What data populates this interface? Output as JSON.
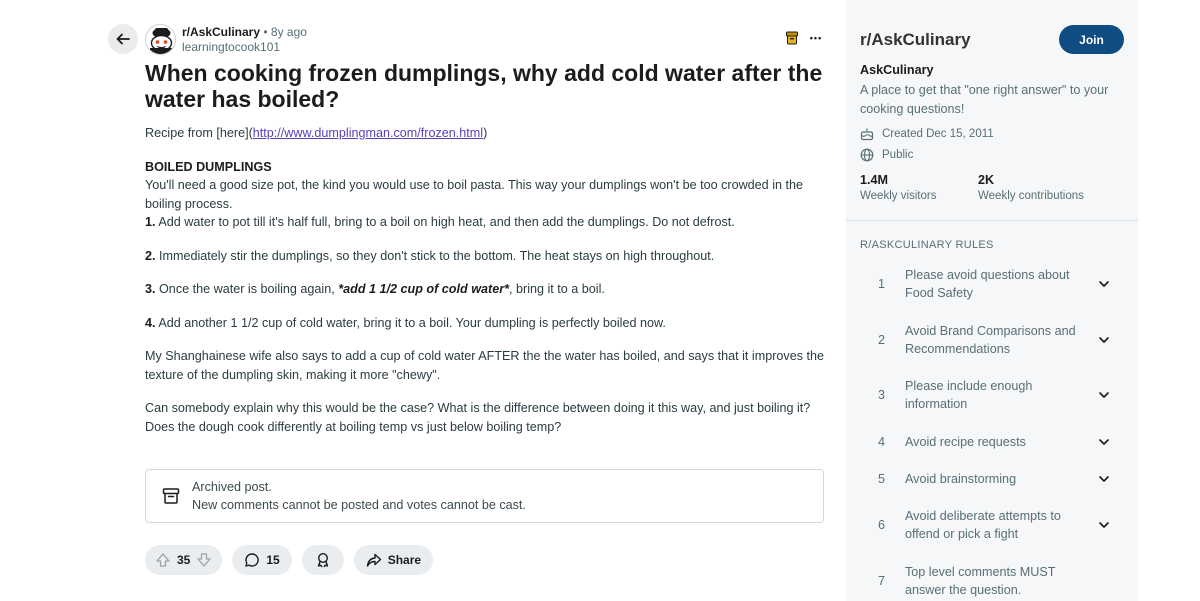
{
  "post": {
    "subreddit": "r/AskCulinary",
    "separator": "•",
    "age": "8y ago",
    "author": "learningtocook101",
    "title": "When cooking frozen dumplings, why add cold water after the water has boiled?",
    "more_label": "•••",
    "body": {
      "recipe_prefix": "Recipe from [here](",
      "recipe_link": "http://www.dumplingman.com/frozen.html",
      "recipe_suffix": ")",
      "heading": "BOILED DUMPLINGS",
      "intro": "You'll need a good size pot, the kind you would use to boil pasta. This way your dumplings won't be too crowded in the boiling process.",
      "step1_num": "1.",
      "step1": " Add water to pot till it's half full, bring to a boil on high heat, and then add the dumplings. Do not defrost.",
      "step2_num": "2.",
      "step2": " Immediately stir the dumplings, so they don't stick to the bottom. The heat stays on high throughout.",
      "step3_num": "3.",
      "step3_pre": " Once the water is boiling again, ",
      "step3_emph": "*add 1 1/2 cup of cold water*",
      "step3_post": ", bring it to a boil.",
      "step4_num": "4.",
      "step4": " Add another 1 1/2 cup of cold water, bring it to a boil. Your dumpling is perfectly boiled now.",
      "para_wife": "My Shanghainese wife also says to add a cup of cold water AFTER the the water has boiled, and says that it improves the texture of the dumpling skin, making it more \"chewy\".",
      "para_question": "Can somebody explain why this would be the case? What is the difference between doing it this way, and just boiling it? Does the dough cook differently at boiling temp vs just below boiling temp?"
    },
    "archived": {
      "title": "Archived post.",
      "subtitle": "New comments cannot be posted and votes cannot be cast."
    },
    "actions": {
      "votes": "35",
      "comments": "15",
      "share": "Share"
    }
  },
  "sidebar": {
    "title": "r/AskCulinary",
    "join": "Join",
    "name": "AskCulinary",
    "description": "A place to get that \"one right answer\" to your cooking questions!",
    "created": "Created Dec 15, 2011",
    "visibility": "Public",
    "stats": [
      {
        "value": "1.4M",
        "label": "Weekly visitors"
      },
      {
        "value": "2K",
        "label": "Weekly contributions"
      }
    ],
    "rules_heading": "R/ASKCULINARY RULES",
    "rules": [
      {
        "num": "1",
        "text": "Please avoid questions about Food Safety"
      },
      {
        "num": "2",
        "text": "Avoid Brand Comparisons and Recommendations"
      },
      {
        "num": "3",
        "text": "Please include enough information"
      },
      {
        "num": "4",
        "text": "Avoid recipe requests"
      },
      {
        "num": "5",
        "text": "Avoid brainstorming"
      },
      {
        "num": "6",
        "text": "Avoid deliberate attempts to offend or pick a fight"
      },
      {
        "num": "7",
        "text": "Top level comments MUST answer the question."
      }
    ]
  },
  "colors": {
    "join_button": "#0f4c81",
    "link": "#5a3fb7",
    "pill_bg": "#eaedef",
    "sidebar_bg": "#f6f7f8"
  },
  "icons": [
    "back-arrow-icon",
    "snoo-avatar-icon",
    "archive-icon",
    "more-icon",
    "upvote-icon",
    "downvote-icon",
    "comment-icon",
    "award-icon",
    "share-icon",
    "cake-icon",
    "globe-icon",
    "chevron-down-icon"
  ]
}
